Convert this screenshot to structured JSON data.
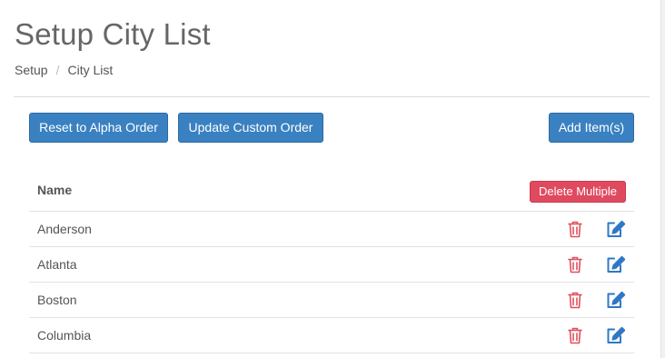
{
  "page": {
    "title": "Setup City List"
  },
  "breadcrumb": {
    "items": [
      "Setup",
      "City List"
    ],
    "separator": "/"
  },
  "toolbar": {
    "reset_label": "Reset to Alpha Order",
    "update_label": "Update Custom Order",
    "add_label": "Add Item(s)"
  },
  "table": {
    "header_name": "Name",
    "delete_multiple_label": "Delete Multiple",
    "rows": [
      {
        "name": "Anderson"
      },
      {
        "name": "Atlanta"
      },
      {
        "name": "Boston"
      },
      {
        "name": "Columbia"
      }
    ]
  },
  "icons": {
    "delete": "trash-icon",
    "edit": "edit-icon"
  },
  "colors": {
    "primary": "#3a81c1",
    "danger": "#e04a5f",
    "trash": "#e0505e",
    "edit": "#2f78c4"
  }
}
